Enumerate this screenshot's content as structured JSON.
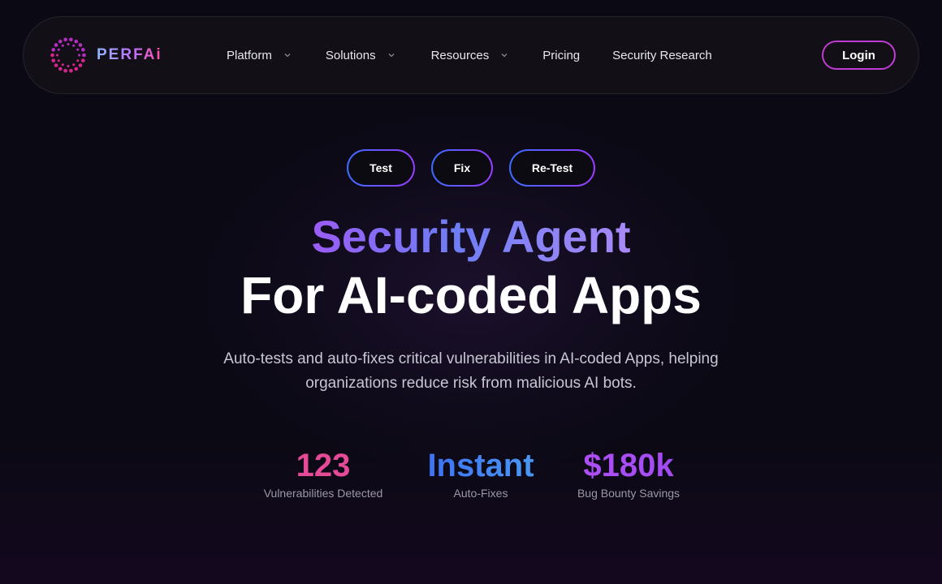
{
  "brand": {
    "name": "PERFAi"
  },
  "nav": {
    "items": [
      {
        "label": "Platform",
        "has_dropdown": true
      },
      {
        "label": "Solutions",
        "has_dropdown": true
      },
      {
        "label": "Resources",
        "has_dropdown": true
      },
      {
        "label": "Pricing",
        "has_dropdown": false
      },
      {
        "label": "Security Research",
        "has_dropdown": false
      }
    ],
    "login_label": "Login"
  },
  "pills": [
    "Test",
    "Fix",
    "Re-Test"
  ],
  "hero": {
    "title_highlight": "Security Agent",
    "title_main": "For AI-coded Apps",
    "description": "Auto-tests and auto-fixes critical vulnerabilities in AI-coded Apps, helping organizations reduce risk from malicious AI bots."
  },
  "stats": [
    {
      "value": "123",
      "label": "Vulnerabilities Detected"
    },
    {
      "value": "Instant",
      "label": "Auto-Fixes"
    },
    {
      "value": "$180k",
      "label": "Bug Bounty Savings"
    }
  ],
  "colors": {
    "background": "#0b0914",
    "accent_pink": "#e44a96",
    "accent_blue": "#3d6ef5",
    "accent_purple": "#b04ef7",
    "login_border": "#c13bd6"
  }
}
